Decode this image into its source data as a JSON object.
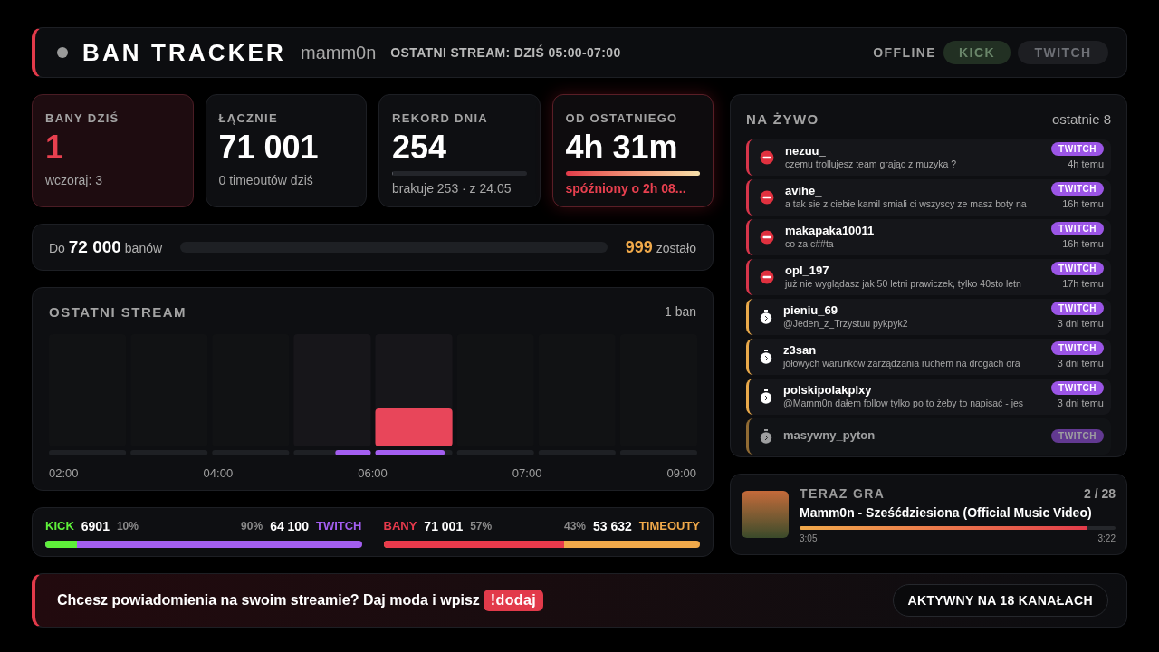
{
  "header": {
    "title": "BAN TRACKER",
    "channel": "mamm0n",
    "last_stream": "OSTATNI STREAM: DZIŚ 05:00-07:00",
    "status": "OFFLINE",
    "platforms": [
      {
        "label": "KICK",
        "selected": true
      },
      {
        "label": "TWITCH",
        "selected": false
      }
    ]
  },
  "stats": [
    {
      "kind": "today",
      "label": "BANY DZIŚ",
      "value": "1",
      "sub": "wczoraj: 3"
    },
    {
      "kind": "plain",
      "label": "ŁĄCZNIE",
      "value": "71 001",
      "sub": "0 timeoutów dziś"
    },
    {
      "kind": "record",
      "label": "REKORD DNIA",
      "value": "254",
      "sub": "brakuje 253 · z 24.05",
      "level": 0.004
    },
    {
      "kind": "since",
      "label": "OD OSTATNIEGO",
      "value": "4h 31m",
      "sub": "spóźniony o 2h 08..."
    }
  ],
  "goal": {
    "prefix": "Do",
    "target": "72 000",
    "suffix": "banów",
    "level": 0,
    "remaining": "999",
    "remaining_label": "zostało"
  },
  "last_stream": {
    "title": "OSTATNI STREAM",
    "count": "1 ban",
    "time_labels": [
      "02:00",
      "04:00",
      "06:00",
      "07:00",
      "09:00"
    ]
  },
  "splits": [
    {
      "left_label": "KICK",
      "left_value": "6901",
      "left_pct": "10%",
      "right_pct": "90%",
      "right_value": "64 100",
      "right_label": "TWITCH",
      "level": 0.1,
      "kind": "platform"
    },
    {
      "left_label": "BANY",
      "left_value": "71 001",
      "left_pct": "57%",
      "right_pct": "43%",
      "right_value": "53 632",
      "right_label": "TIMEOUTY",
      "level": 0.57,
      "kind": "action"
    }
  ],
  "live": {
    "title": "NA ŻYWO",
    "count": "ostatnie 8",
    "items": [
      {
        "kind": "ban",
        "user": "nezuu_",
        "message": "czemu trollujesz team grając z muzyka ?",
        "platform": "TWITCH",
        "time": "4h temu"
      },
      {
        "kind": "ban",
        "user": "avihe_",
        "message": "a tak sie z ciebie kamil smiali ci wszyscy ze masz boty na",
        "platform": "TWITCH",
        "time": "16h temu"
      },
      {
        "kind": "ban",
        "user": "makapaka10011",
        "message": "co za c##ta",
        "platform": "TWITCH",
        "time": "16h temu"
      },
      {
        "kind": "ban",
        "user": "opl_197",
        "message": "już nie wyglądasz jak 50 letni prawiczek, tylko 40sto letn",
        "platform": "TWITCH",
        "time": "17h temu"
      },
      {
        "kind": "timeout",
        "user": "pieniu_69",
        "message": "@Jeden_z_Trzystuu pykpyk2",
        "platform": "TWITCH",
        "time": "3 dni temu"
      },
      {
        "kind": "timeout",
        "user": "z3san",
        "message": "jółowych warunków zarządzania ruchem na drogach ora",
        "platform": "TWITCH",
        "time": "3 dni temu"
      },
      {
        "kind": "timeout",
        "user": "polskipolakplxy",
        "message": "@Mamm0n dałem follow tylko po to żeby to napisać - jes",
        "platform": "TWITCH",
        "time": "3 dni temu"
      },
      {
        "kind": "timeout",
        "user": "masywny_pyton",
        "platform": "TWITCH",
        "faded": true
      }
    ]
  },
  "now_playing": {
    "title": "TERAZ GRA",
    "position": "2 / 28",
    "song": "Mamm0n - Sześćdziesiona (Official Music Video)",
    "level": 0.91,
    "elapsed": "3:05",
    "duration": "3:22"
  },
  "footer": {
    "text": "Chcesz powiadomienia na swoim streamie? Daj moda i wpisz",
    "command": "!dodaj",
    "button": "AKTYWNY NA 18 KANAŁACH"
  }
}
